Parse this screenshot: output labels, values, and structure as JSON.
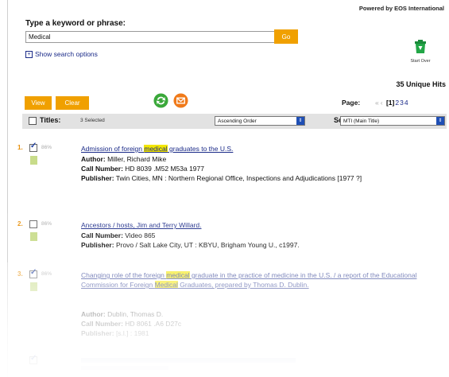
{
  "header": {
    "powered_by": "Powered by EOS International"
  },
  "search": {
    "label": "Type a keyword or phrase:",
    "value": "Medical",
    "go_label": "Go",
    "show_options": "Show search options",
    "start_over": "Start Over"
  },
  "summary": {
    "unique_hits": "35 Unique Hits"
  },
  "toolbar": {
    "view_label": "View",
    "clear_label": "Clear"
  },
  "pager": {
    "label": "Page:",
    "current": "[1]",
    "pages": [
      "2",
      "3",
      "4"
    ]
  },
  "titles_bar": {
    "titles_label": "Titles:",
    "selected": "3 Selected",
    "order_value": "Ascending Order",
    "sort_label": "Sort:",
    "sort_value": "MTI (Main Title)"
  },
  "results": [
    {
      "num": "1.",
      "checked": true,
      "score": "86%",
      "title_before": "Admission of foreign ",
      "title_hl1": "medical",
      "title_mid": " graduates to the U.S.",
      "title_hl2": "",
      "title_after": "",
      "author_label": "Author:",
      "author": "Miller, Richard Mike",
      "call_label": "Call Number:",
      "call": "HD 8039 .M52 M53a 1977",
      "pub_label": "Publisher:",
      "publisher": "Twin Cities, MN : Northern Regional Office, Inspections and Adjudications [1977 ?]"
    },
    {
      "num": "2.",
      "checked": false,
      "score": "86%",
      "title_before": "Ancestors / hosts, Jim and Terry Willard.",
      "title_hl1": "",
      "title_mid": "",
      "title_hl2": "",
      "title_after": "",
      "author_label": "",
      "author": "",
      "call_label": "Call Number:",
      "call": "Video 865",
      "pub_label": "Publisher:",
      "publisher": "Provo / Salt Lake City, UT : KBYU, Brigham Young U., c1997."
    },
    {
      "num": "3.",
      "checked": true,
      "score": "86%",
      "title_before": "Changing role of the foreign ",
      "title_hl1": "medical",
      "title_mid": " graduate in the practice of medicine in the U.S. / a report of the Educational Commission for Foreign ",
      "title_hl2": "Medical",
      "title_after": " Graduates, prepared by Thomas D. Dublin.",
      "author_label": "Author:",
      "author": "Dublin, Thomas D.",
      "call_label": "Call Number:",
      "call": "HD 8061 .A6 D27c",
      "pub_label": "Publisher:",
      "publisher": "[s.l.] : 1981"
    }
  ],
  "colors": {
    "accent_orange": "#f0a000",
    "link_blue": "#1a2a88",
    "highlight_yellow": "#f3e600",
    "title_bar_gray": "#e2e2e2",
    "number_orange": "#e8900a"
  },
  "icons": {
    "start_over": "green-trash-can-icon",
    "save": "green-circle-arrows-icon",
    "email": "orange-circle-envelope-icon",
    "record": "green-document-icon"
  }
}
